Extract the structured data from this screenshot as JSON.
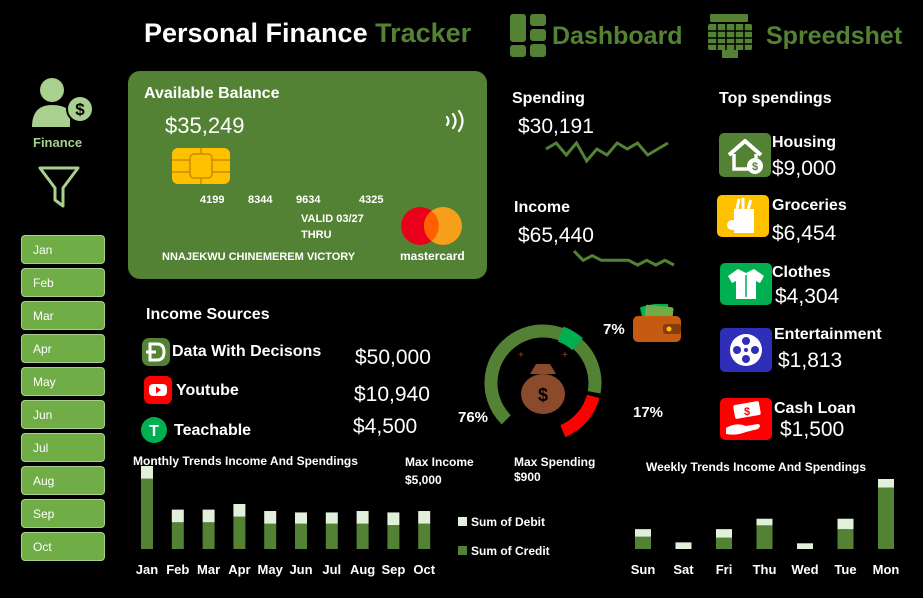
{
  "header": {
    "title_part1": "Personal Finance ",
    "title_part2": "Tracker",
    "nav_dashboard": "Dashboard",
    "nav_spreadsheet": "Spreedshet"
  },
  "sidebar": {
    "finance_label": "Finance",
    "months": [
      "Jan",
      "Feb",
      "Mar",
      "Apr",
      "May",
      "Jun",
      "Jul",
      "Aug",
      "Sep",
      "Oct"
    ]
  },
  "card": {
    "label": "Available Balance",
    "balance": "$35,249",
    "number_groups": [
      "4199",
      "8344",
      "9634",
      "4325"
    ],
    "valid_label": "VALID 03/27",
    "thru_label": "THRU",
    "holder": "NNAJEKWU CHINEMEREM VICTORY",
    "brand": "mastercard"
  },
  "spending": {
    "label": "Spending",
    "value": "$30,191"
  },
  "income": {
    "label": "Income",
    "value": "$65,440"
  },
  "income_sources": {
    "title": "Income Sources",
    "items": [
      {
        "name": "Data With Decisons",
        "value": "$50,000",
        "icon": "data-with-decisions-logo",
        "color": "#548235"
      },
      {
        "name": "Youtube",
        "value": "$10,940",
        "icon": "youtube-logo",
        "color": "#ff0000"
      },
      {
        "name": "Teachable",
        "value": "$4,500",
        "icon": "teachable-logo",
        "color": "#00b050"
      }
    ]
  },
  "donut": {
    "pct_76": "76%",
    "pct_17": "17%",
    "pct_7": "7%",
    "segments": [
      {
        "label": "76%",
        "value": 76,
        "color": "#548235"
      },
      {
        "label": "17%",
        "value": 17,
        "color": "#ff0000"
      },
      {
        "label": "7%",
        "value": 7,
        "color": "#00b050"
      }
    ]
  },
  "top_spendings": {
    "title": "Top spendings",
    "items": [
      {
        "name": "Housing",
        "value": "$9,000",
        "icon": "house-money-icon",
        "color": "#548235"
      },
      {
        "name": "Groceries",
        "value": "$6,454",
        "icon": "groceries-bag-icon",
        "color": "#ffc000"
      },
      {
        "name": "Clothes",
        "value": "$4,304",
        "icon": "shirt-icon",
        "color": "#00b050"
      },
      {
        "name": "Entertainment",
        "value": "$1,813",
        "icon": "film-reel-icon",
        "color": "#2e2eb8"
      },
      {
        "name": "Cash Loan",
        "value": "$1,500",
        "icon": "cash-hand-icon",
        "color": "#ff0000"
      }
    ]
  },
  "monthly_chart": {
    "title": "Monthly Trends Income And Spendings",
    "max_income_label": "Max Income",
    "max_income_value": "$5,000",
    "max_spending_label": "Max Spending",
    "max_spending_value": "$900",
    "legend_debit": "Sum of Debit",
    "legend_credit": "Sum of Credit"
  },
  "weekly_chart": {
    "title": "Weekly Trends Income And Spendings"
  },
  "chart_data": [
    {
      "type": "bar",
      "title": "Monthly Trends Income And Spendings",
      "categories": [
        "Jan",
        "Feb",
        "Mar",
        "Apr",
        "May",
        "Jun",
        "Jul",
        "Aug",
        "Sep",
        "Oct"
      ],
      "series": [
        {
          "name": "Sum of Credit",
          "color": "#548235",
          "values": [
            5000,
            1900,
            1900,
            2300,
            1800,
            1800,
            1800,
            1800,
            1700,
            1800
          ]
        },
        {
          "name": "Sum of Debit",
          "color": "#e2efda",
          "values": [
            900,
            900,
            900,
            900,
            900,
            800,
            800,
            900,
            900,
            900
          ]
        }
      ],
      "stacked": true,
      "ylim": [
        0,
        5900
      ]
    },
    {
      "type": "bar",
      "title": "Weekly Trends Income And Spendings",
      "categories": [
        "Sun",
        "Sat",
        "Fri",
        "Thu",
        "Wed",
        "Tue",
        "Mon"
      ],
      "series": [
        {
          "name": "Sum of Credit",
          "color": "#548235",
          "values": [
            1300,
            0,
            1200,
            2500,
            0,
            2100,
            6500
          ]
        },
        {
          "name": "Sum of Debit",
          "color": "#e2efda",
          "values": [
            800,
            700,
            900,
            700,
            600,
            1100,
            900
          ]
        }
      ],
      "stacked": true,
      "ylim": [
        0,
        7400
      ]
    }
  ],
  "sparklines": {
    "spending": [
      5,
      6,
      4,
      6,
      3,
      5,
      4,
      6,
      5,
      6,
      4,
      5,
      6
    ],
    "income": [
      7,
      5,
      6,
      5,
      5,
      5,
      5,
      4,
      5,
      4,
      5,
      4
    ]
  }
}
